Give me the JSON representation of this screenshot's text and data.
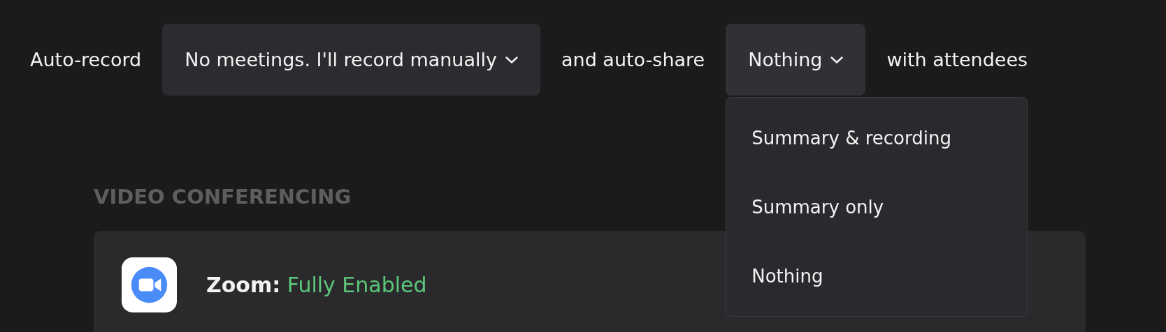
{
  "auto_record": {
    "label": "Auto-record",
    "recording_dropdown": {
      "value": "No meetings. I'll record manually"
    },
    "connector": "and auto-share",
    "share_dropdown": {
      "value": "Nothing",
      "expanded": true,
      "options": [
        {
          "label": "Summary & recording"
        },
        {
          "label": "Summary only"
        },
        {
          "label": "Nothing"
        }
      ]
    },
    "suffix": "with attendees"
  },
  "video_conferencing": {
    "heading": "VIDEO CONFERENCING",
    "integrations": [
      {
        "name": "Zoom:",
        "status": "Fully Enabled"
      }
    ]
  }
}
